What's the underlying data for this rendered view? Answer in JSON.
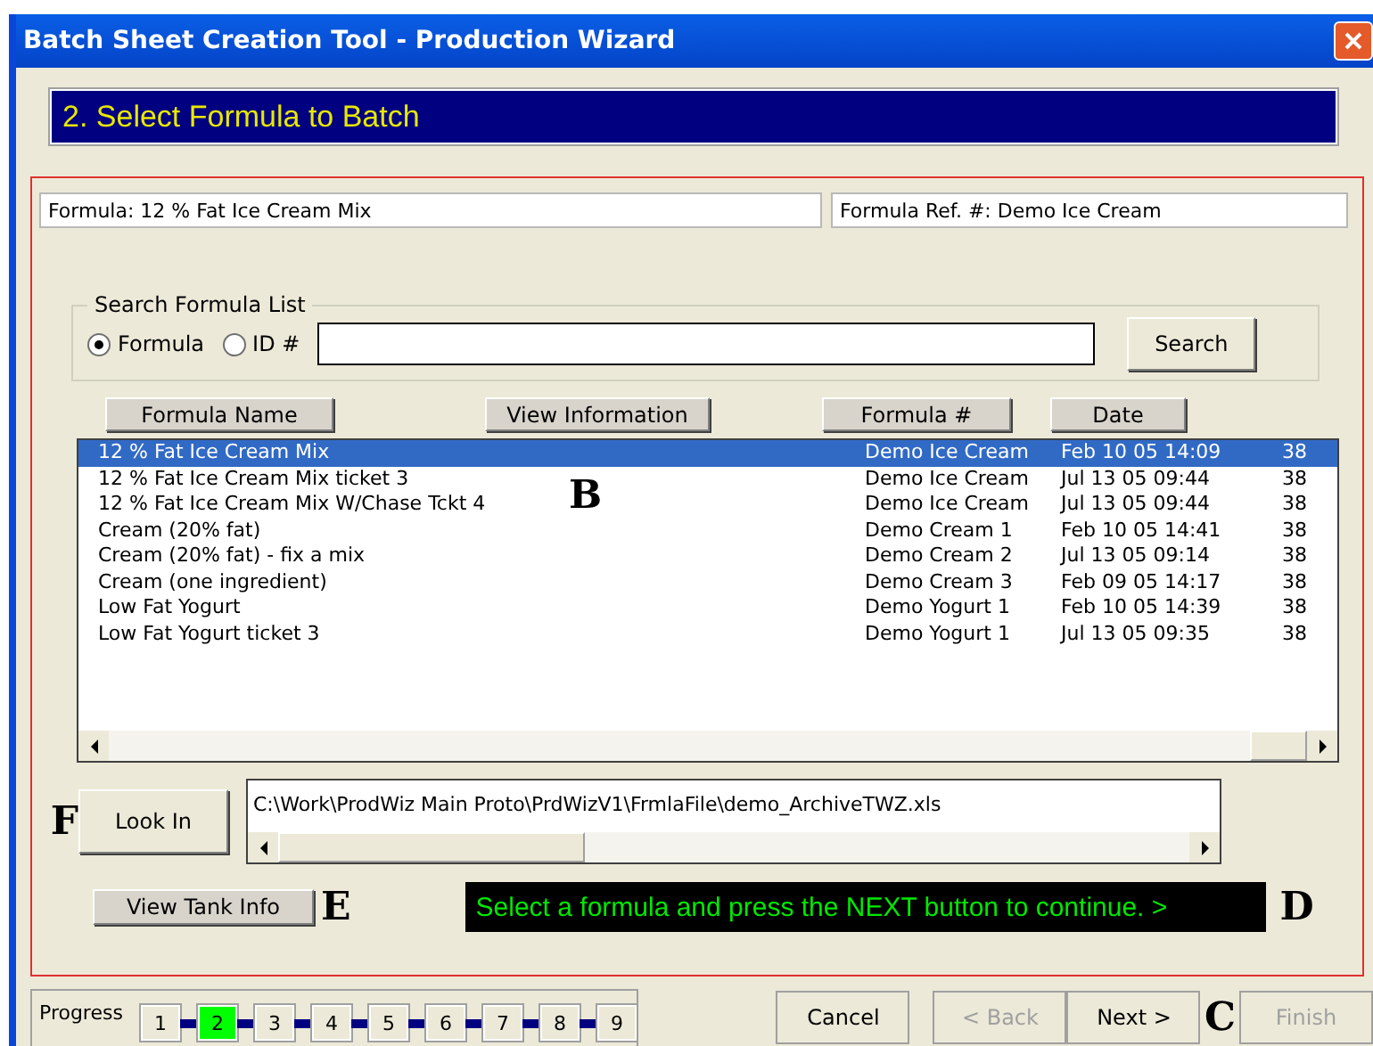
{
  "window": {
    "title": "Batch Sheet Creation Tool - Production Wizard"
  },
  "step_banner": "2. Select Formula to Batch",
  "formula_field": {
    "value": "Formula: 12 % Fat Ice Cream Mix"
  },
  "ref_field": {
    "value": "Formula Ref. #:  Demo Ice Cream"
  },
  "search": {
    "legend": "Search Formula List",
    "options": [
      {
        "label": "Formula",
        "selected": true
      },
      {
        "label": "ID #",
        "selected": false
      }
    ],
    "button": "Search"
  },
  "column_buttons": [
    "Formula Name",
    "View Information",
    "Formula #",
    "Date"
  ],
  "list": {
    "callout": "B",
    "rows": [
      {
        "name": "12 % Fat Ice Cream Mix",
        "ref": "Demo Ice Cream",
        "date": "Feb 10 05  14:09",
        "column_5": "38",
        "selected": true
      },
      {
        "name": "12 % Fat Ice Cream Mix ticket 3",
        "ref": "Demo Ice Cream",
        "date": "Jul 13 05  09:44",
        "column_5": "38",
        "selected": false
      },
      {
        "name": "12 % Fat Ice Cream Mix W/Chase Tckt 4",
        "ref": "Demo Ice Cream",
        "date": "Jul 13 05  09:44",
        "column_5": "38",
        "selected": false
      },
      {
        "name": "Cream (20% fat)",
        "ref": "Demo Cream 1",
        "date": "Feb 10 05  14:41",
        "column_5": "38",
        "selected": false
      },
      {
        "name": "Cream (20% fat) - fix a mix",
        "ref": "Demo Cream 2",
        "date": "Jul 13 05  09:14",
        "column_5": "38",
        "selected": false
      },
      {
        "name": "Cream (one ingredient)",
        "ref": "Demo Cream 3",
        "date": "Feb 09 05  14:17",
        "column_5": "38",
        "selected": false
      },
      {
        "name": "Low Fat Yogurt",
        "ref": "Demo Yogurt 1",
        "date": "Feb 10 05  14:39",
        "column_5": "38",
        "selected": false
      },
      {
        "name": "Low Fat Yogurt ticket 3",
        "ref": "Demo Yogurt 1",
        "date": "Jul 13 05  09:35",
        "column_5": "38",
        "selected": false
      }
    ]
  },
  "look_in": {
    "callout": "F",
    "button": "Look In",
    "path": "C:\\Work\\ProdWiz Main Proto\\PrdWizV1\\FrmlaFile\\demo_ArchiveTWZ.xls"
  },
  "tank": {
    "button": "View Tank Info",
    "callout": "E"
  },
  "message": {
    "text": "Select a formula and press the NEXT button to continue. >",
    "callout": "D"
  },
  "progress": {
    "label": "Progress",
    "steps": [
      {
        "label": "1",
        "selected": false
      },
      {
        "label": "2",
        "selected": true
      },
      {
        "label": "3",
        "selected": false
      },
      {
        "label": "4",
        "selected": false
      },
      {
        "label": "5",
        "selected": false
      },
      {
        "label": "6",
        "selected": false
      },
      {
        "label": "7",
        "selected": false
      },
      {
        "label": "8",
        "selected": false
      },
      {
        "label": "9",
        "selected": false
      }
    ]
  },
  "nav": {
    "callout": "C",
    "buttons": [
      {
        "label": "Cancel",
        "disabled": false
      },
      {
        "label": "< Back",
        "disabled": true
      },
      {
        "label": "Next >",
        "disabled": false
      },
      {
        "label": "Finish",
        "disabled": true
      }
    ]
  }
}
